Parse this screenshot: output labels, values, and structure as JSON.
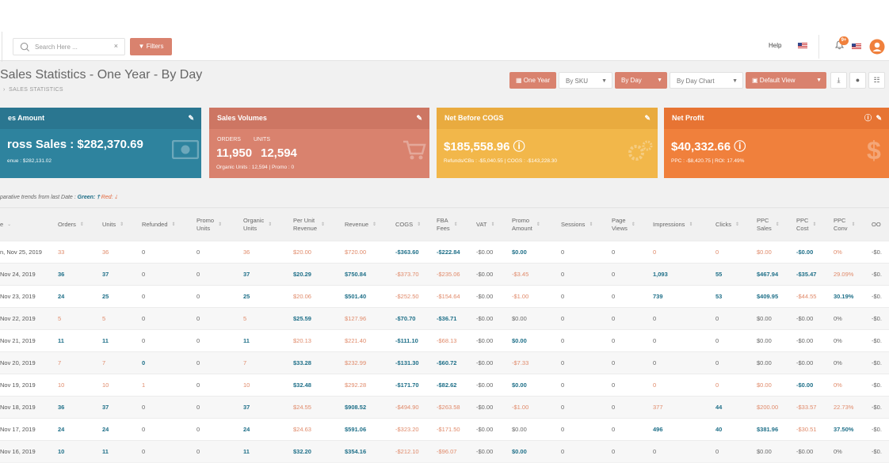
{
  "topbar": {
    "search_placeholder": "Search Here ...",
    "clear_label": "×",
    "filters_label": "Filters",
    "help_label": "Help",
    "notif_badge": "9+"
  },
  "page": {
    "title": "Sales Statistics - One Year - By Day",
    "breadcrumb": "SALES STATISTICS"
  },
  "toolbar": {
    "one_year": "One Year",
    "by_sku": "By SKU",
    "by_day": "By Day",
    "by_day_chart": "By Day Chart",
    "default_view": "Default View"
  },
  "cards": {
    "sales_amount": {
      "title": "es Amount",
      "main": "ross Sales : $282,370.69",
      "sub": "enue : $282,131.02"
    },
    "sales_volumes": {
      "title": "Sales Volumes",
      "orders_label": "ORDERS",
      "units_label": "UNITS",
      "orders": "11,950",
      "units": "12,594",
      "sub": "Organic Units : 12,594  |  Promo : 0"
    },
    "net_before_cogs": {
      "title": "Net Before COGS",
      "main": "$185,558.96",
      "sub": "Refunds/CBs : -$5,040.55  |  COGS : -$143,228.30"
    },
    "net_profit": {
      "title": "Net Profit",
      "main": "$40,332.66",
      "sub": "PPC : -$8,420.75  |  ROI: 17.49%"
    }
  },
  "trend": {
    "prefix": "parative trends from last Date : ",
    "green": "Green:",
    "red": "Red:"
  },
  "colors": {
    "blue": "#2e839e",
    "salmon": "#d9826e",
    "yellow": "#f2b74a",
    "orange": "#f0803c"
  },
  "table": {
    "headers": [
      {
        "label": "e",
        "sort": "⌄"
      },
      {
        "label": "Orders",
        "sort": "⇕"
      },
      {
        "label": "Units",
        "sort": "⇕"
      },
      {
        "label": "Refunded",
        "sort": "⇕"
      },
      {
        "label": "Promo\nUnits",
        "sort": "⇕"
      },
      {
        "label": "Organic\nUnits",
        "sort": "⇕"
      },
      {
        "label": "Per Unit\nRevenue",
        "sort": "⇕"
      },
      {
        "label": "Revenue",
        "sort": "⇕"
      },
      {
        "label": "COGS",
        "sort": "⇕"
      },
      {
        "label": "FBA\nFees",
        "sort": "⇕"
      },
      {
        "label": "VAT",
        "sort": "⇕"
      },
      {
        "label": "Promo\nAmount",
        "sort": "⇕"
      },
      {
        "label": "Sessions",
        "sort": "⇕"
      },
      {
        "label": "Page\nViews",
        "sort": "⇕"
      },
      {
        "label": "Impressions",
        "sort": "⇕"
      },
      {
        "label": "Clicks",
        "sort": "⇕"
      },
      {
        "label": "PPC\nSales",
        "sort": "⇕"
      },
      {
        "label": "PPC\nCost",
        "sort": "⇕"
      },
      {
        "label": "PPC\nConv",
        "sort": "⇕"
      },
      {
        "label": "OO",
        "sort": ""
      }
    ],
    "rows": [
      [
        "n, Nov 25, 2019",
        "33",
        "36",
        "0",
        "0",
        "36",
        "$20.00",
        "$720.00",
        "-$363.60",
        "-$222.84",
        "-$0.00",
        "$0.00",
        "0",
        "0",
        "0",
        "0",
        "$0.00",
        "-$0.00",
        "0%",
        "-$0."
      ],
      [
        "Nov 24, 2019",
        "36",
        "37",
        "0",
        "0",
        "37",
        "$20.29",
        "$750.84",
        "-$373.70",
        "-$235.06",
        "-$0.00",
        "-$3.45",
        "0",
        "0",
        "1,093",
        "55",
        "$467.94",
        "-$35.47",
        "29.09%",
        "-$0."
      ],
      [
        "Nov 23, 2019",
        "24",
        "25",
        "0",
        "0",
        "25",
        "$20.06",
        "$501.40",
        "-$252.50",
        "-$154.64",
        "-$0.00",
        "-$1.00",
        "0",
        "0",
        "739",
        "53",
        "$409.95",
        "-$44.55",
        "30.19%",
        "-$0."
      ],
      [
        "Nov 22, 2019",
        "5",
        "5",
        "0",
        "0",
        "5",
        "$25.59",
        "$127.96",
        "-$70.70",
        "-$36.71",
        "-$0.00",
        "$0.00",
        "0",
        "0",
        "0",
        "0",
        "$0.00",
        "-$0.00",
        "0%",
        "-$0."
      ],
      [
        "Nov 21, 2019",
        "11",
        "11",
        "0",
        "0",
        "11",
        "$20.13",
        "$221.40",
        "-$111.10",
        "-$68.13",
        "-$0.00",
        "$0.00",
        "0",
        "0",
        "0",
        "0",
        "$0.00",
        "-$0.00",
        "0%",
        "-$0."
      ],
      [
        "Nov 20, 2019",
        "7",
        "7",
        "0",
        "0",
        "7",
        "$33.28",
        "$232.99",
        "-$131.30",
        "-$60.72",
        "-$0.00",
        "-$7.33",
        "0",
        "0",
        "0",
        "0",
        "$0.00",
        "-$0.00",
        "0%",
        "-$0."
      ],
      [
        "Nov 19, 2019",
        "10",
        "10",
        "1",
        "0",
        "10",
        "$32.48",
        "$292.28",
        "-$171.70",
        "-$82.62",
        "-$0.00",
        "$0.00",
        "0",
        "0",
        "0",
        "0",
        "$0.00",
        "-$0.00",
        "0%",
        "-$0."
      ],
      [
        "Nov 18, 2019",
        "36",
        "37",
        "0",
        "0",
        "37",
        "$24.55",
        "$908.52",
        "-$494.90",
        "-$263.58",
        "-$0.00",
        "-$1.00",
        "0",
        "0",
        "377",
        "44",
        "$200.00",
        "-$33.57",
        "22.73%",
        "-$0."
      ],
      [
        "Nov 17, 2019",
        "24",
        "24",
        "0",
        "0",
        "24",
        "$24.63",
        "$591.06",
        "-$323.20",
        "-$171.50",
        "-$0.00",
        "$0.00",
        "0",
        "0",
        "496",
        "40",
        "$381.96",
        "-$30.51",
        "37.50%",
        "-$0."
      ],
      [
        "Nov 16, 2019",
        "10",
        "11",
        "0",
        "0",
        "11",
        "$32.20",
        "$354.16",
        "-$212.10",
        "-$96.07",
        "-$0.00",
        "$0.00",
        "0",
        "0",
        "0",
        "0",
        "$0.00",
        "-$0.00",
        "0%",
        "-$0."
      ]
    ],
    "row_styles": [
      [
        "dark",
        "or",
        "or",
        "gray",
        "gray",
        "or",
        "or",
        "or",
        "blue",
        "blue",
        "gray",
        "blue",
        "gray",
        "gray",
        "or",
        "or",
        "or",
        "blue",
        "or",
        "gray"
      ],
      [
        "dark",
        "blue",
        "blue",
        "gray",
        "gray",
        "blue",
        "blue",
        "blue",
        "or",
        "or",
        "gray",
        "or",
        "gray",
        "gray",
        "blue",
        "blue",
        "blue",
        "blue",
        "or",
        "gray"
      ],
      [
        "dark",
        "blue",
        "blue",
        "gray",
        "gray",
        "blue",
        "or",
        "blue",
        "or",
        "or",
        "gray",
        "or",
        "gray",
        "gray",
        "blue",
        "blue",
        "blue",
        "or",
        "blue",
        "gray"
      ],
      [
        "dark",
        "or",
        "or",
        "gray",
        "gray",
        "or",
        "blue",
        "or",
        "blue",
        "blue",
        "gray",
        "gray",
        "gray",
        "gray",
        "gray",
        "gray",
        "gray",
        "gray",
        "gray",
        "gray"
      ],
      [
        "dark",
        "blue",
        "blue",
        "gray",
        "gray",
        "blue",
        "or",
        "or",
        "blue",
        "or",
        "gray",
        "blue",
        "gray",
        "gray",
        "gray",
        "gray",
        "gray",
        "gray",
        "gray",
        "gray"
      ],
      [
        "dark",
        "or",
        "or",
        "blue",
        "gray",
        "or",
        "blue",
        "or",
        "blue",
        "blue",
        "gray",
        "or",
        "gray",
        "gray",
        "gray",
        "gray",
        "gray",
        "gray",
        "gray",
        "gray"
      ],
      [
        "dark",
        "or",
        "or",
        "or",
        "gray",
        "or",
        "blue",
        "or",
        "blue",
        "blue",
        "gray",
        "blue",
        "gray",
        "gray",
        "or",
        "or",
        "or",
        "blue",
        "or",
        "gray"
      ],
      [
        "dark",
        "blue",
        "blue",
        "gray",
        "gray",
        "blue",
        "or",
        "blue",
        "or",
        "or",
        "gray",
        "or",
        "gray",
        "gray",
        "or",
        "blue",
        "or",
        "or",
        "or",
        "gray"
      ],
      [
        "dark",
        "blue",
        "blue",
        "gray",
        "gray",
        "blue",
        "or",
        "blue",
        "or",
        "or",
        "gray",
        "gray",
        "gray",
        "gray",
        "blue",
        "blue",
        "blue",
        "or",
        "blue",
        "gray"
      ],
      [
        "dark",
        "blue",
        "blue",
        "gray",
        "gray",
        "blue",
        "blue",
        "blue",
        "or",
        "or",
        "gray",
        "blue",
        "gray",
        "gray",
        "gray",
        "gray",
        "gray",
        "gray",
        "gray",
        "gray"
      ]
    ]
  }
}
